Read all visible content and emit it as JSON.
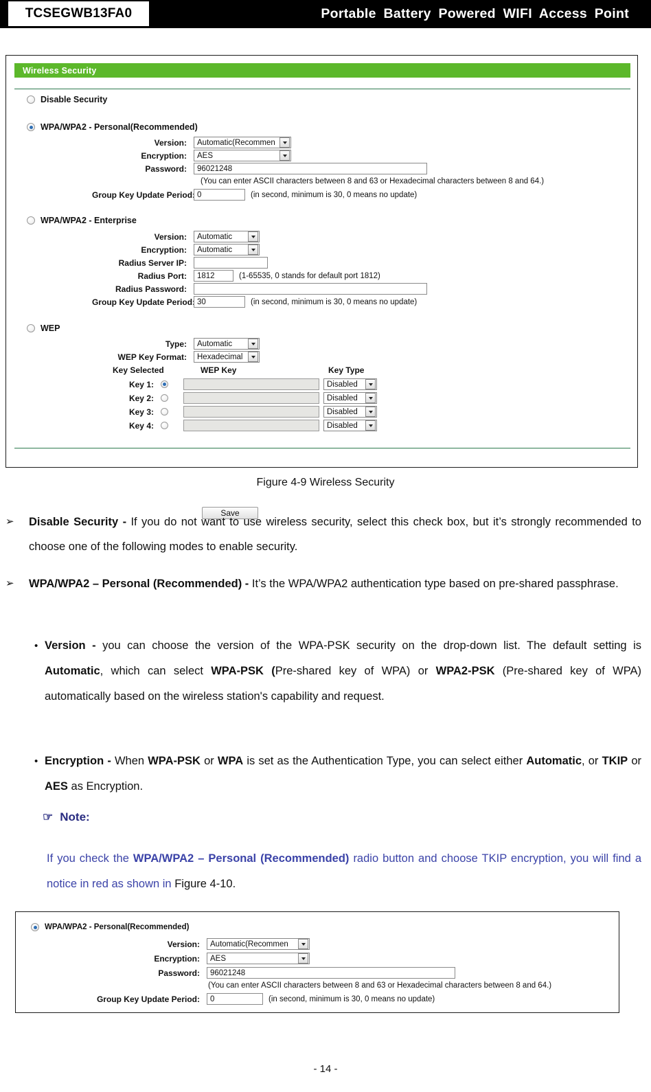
{
  "header": {
    "model": "TCSEGWB13FA0",
    "title": "Portable  Battery  Powered  WIFI  Access  Point"
  },
  "figure1": {
    "panel_title": "Wireless Security",
    "save_label": "Save",
    "caption": "Figure 4-9 Wireless Security",
    "groups": {
      "disable": {
        "label": "Disable Security",
        "selected": false
      },
      "personal": {
        "label": "WPA/WPA2 - Personal(Recommended)",
        "selected": true
      },
      "enterprise": {
        "label": "WPA/WPA2 - Enterprise",
        "selected": false
      },
      "wep": {
        "label": "WEP",
        "selected": false
      }
    },
    "personal": {
      "version_label": "Version:",
      "version_value": "Automatic(Recommen",
      "encryption_label": "Encryption:",
      "encryption_value": "AES",
      "password_label": "Password:",
      "password_value": "96021248",
      "password_hint": "(You can enter ASCII characters between 8 and 63 or Hexadecimal characters between 8 and 64.)",
      "gkup_label": "Group Key Update Period:",
      "gkup_value": "0",
      "gkup_hint": "(in second, minimum is 30, 0 means no update)"
    },
    "enterprise": {
      "version_label": "Version:",
      "version_value": "Automatic",
      "encryption_label": "Encryption:",
      "encryption_value": "Automatic",
      "radius_ip_label": "Radius Server IP:",
      "radius_ip_value": "",
      "radius_port_label": "Radius Port:",
      "radius_port_value": "1812",
      "radius_port_hint": "(1-65535, 0 stands for default port 1812)",
      "radius_password_label": "Radius Password:",
      "radius_password_value": "",
      "gkup_label": "Group Key Update Period:",
      "gkup_value": "30",
      "gkup_hint": "(in second, minimum is 30, 0 means no update)"
    },
    "wep": {
      "type_label": "Type:",
      "type_value": "Automatic",
      "keyformat_label": "WEP Key Format:",
      "keyformat_value": "Hexadecimal",
      "col_key_selected": "Key Selected",
      "col_wep_key": "WEP Key",
      "col_key_type": "Key Type",
      "keys": [
        {
          "label": "Key 1:",
          "selected": true,
          "value": "",
          "type": "Disabled"
        },
        {
          "label": "Key 2:",
          "selected": false,
          "value": "",
          "type": "Disabled"
        },
        {
          "label": "Key 3:",
          "selected": false,
          "value": "",
          "type": "Disabled"
        },
        {
          "label": "Key 4:",
          "selected": false,
          "value": "",
          "type": "Disabled"
        }
      ]
    }
  },
  "prose": {
    "bullet_arrow": "➢",
    "bullet_dot": "•",
    "hand_icon": "☞",
    "item1_term": "Disable Security - ",
    "item1_text": "If you do not want to use wireless security, select this check box, but it’s strongly recommended to choose one of the following modes to enable security.",
    "item2_term": "WPA/WPA2 – Personal (Recommended) - ",
    "item2_text": "It’s the WPA/WPA2 authentication type based on pre-shared passphrase.",
    "item3_term": "Version  - ",
    "item3_text_a": "you can choose the version of the WPA-PSK security on the drop-down list. The default setting is ",
    "item3_bold_a": "Automatic",
    "item3_text_b": ", which can select ",
    "item3_bold_b": "WPA-PSK (",
    "item3_text_c": "Pre-shared key of WPA) or ",
    "item3_bold_c": "WPA2-PSK",
    "item3_text_d": "  (Pre-shared key of WPA) automatically based on the wireless station's capability and request.",
    "item4_term": "Encryption  - ",
    "item4_text_a": "When ",
    "item4_bold_a": "WPA-PSK",
    "item4_text_b": " or ",
    "item4_bold_b": "WPA",
    "item4_text_c": " is set as the Authentication Type, you can select either ",
    "item4_bold_c": "Automatic",
    "item4_text_d": ", or ",
    "item4_bold_d": "TKIP",
    "item4_text_e": " or ",
    "item4_bold_e": "AES",
    "item4_text_f": " as Encryption.",
    "note_label": "Note:",
    "note_text_a": "If you check the ",
    "note_bold_a": "WPA/WPA2 – Personal (Recommended)",
    "note_text_b": " radio button and choose TKIP encryption, you will find a notice in red as shown in ",
    "note_text_c": "Figure 4-10."
  },
  "figure2": {
    "group_label": "WPA/WPA2 - Personal(Recommended)",
    "version_label": "Version:",
    "version_value": "Automatic(Recommen",
    "encryption_label": "Encryption:",
    "encryption_value": "AES",
    "password_label": "Password:",
    "password_value": "96021248",
    "password_hint": "(You can enter ASCII characters between 8 and 63 or Hexadecimal characters between 8 and 64.)",
    "gkup_label": "Group Key Update Period:",
    "gkup_value": "0",
    "gkup_hint": "(in second, minimum is 30, 0 means no update)"
  },
  "footer": {
    "page": "- 14 -"
  }
}
